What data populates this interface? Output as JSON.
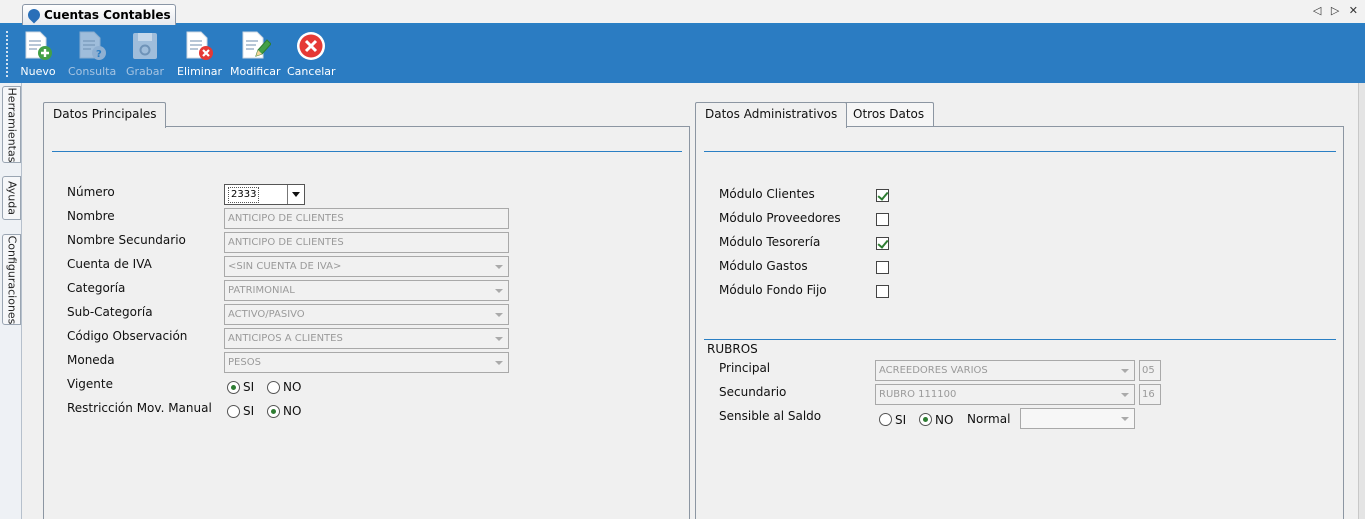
{
  "window": {
    "tab_title": "Cuentas Contables",
    "controls": "◁ ▷ ✕"
  },
  "toolbar": {
    "buttons": [
      {
        "label": "Nuevo",
        "icon": "new-document-icon",
        "enabled": true
      },
      {
        "label": "Consulta",
        "icon": "query-document-icon",
        "enabled": false
      },
      {
        "label": "Grabar",
        "icon": "save-disk-icon",
        "enabled": false
      },
      {
        "label": "Eliminar",
        "icon": "delete-document-icon",
        "enabled": true
      },
      {
        "label": "Modificar",
        "icon": "edit-document-icon",
        "enabled": true
      },
      {
        "label": "Cancelar",
        "icon": "cancel-icon",
        "enabled": true
      }
    ]
  },
  "sidebar": {
    "tabs": [
      "Herramientas",
      "Ayuda",
      "Configuraciones"
    ]
  },
  "main_panel": {
    "tab": "Datos Principales",
    "fields": {
      "numero": {
        "label": "Número",
        "value": "2333"
      },
      "nombre": {
        "label": "Nombre",
        "value": "ANTICIPO DE CLIENTES"
      },
      "nombre_secundario": {
        "label": "Nombre Secundario",
        "value": "ANTICIPO DE CLIENTES"
      },
      "cuenta_iva": {
        "label": "Cuenta de IVA",
        "value": "<SIN CUENTA DE IVA>"
      },
      "categoria": {
        "label": "Categoría",
        "value": "PATRIMONIAL"
      },
      "sub_categoria": {
        "label": "Sub-Categoría",
        "value": "ACTIVO/PASIVO"
      },
      "codigo_observacion": {
        "label": "Código Observación",
        "value": "ANTICIPOS A CLIENTES"
      },
      "moneda": {
        "label": "Moneda",
        "value": "PESOS"
      },
      "vigente": {
        "label": "Vigente",
        "options": [
          "SI",
          "NO"
        ],
        "selected": "SI"
      },
      "restriccion": {
        "label": "Restricción Mov. Manual",
        "options": [
          "SI",
          "NO"
        ],
        "selected": "NO"
      }
    }
  },
  "admin_panel": {
    "tabs": [
      "Datos Administrativos",
      "Otros Datos"
    ],
    "active_tab": "Datos Administrativos",
    "modules": [
      {
        "label": "Módulo Clientes",
        "checked": true
      },
      {
        "label": "Módulo Proveedores",
        "checked": false
      },
      {
        "label": "Módulo Tesorería",
        "checked": true
      },
      {
        "label": "Módulo Gastos",
        "checked": false
      },
      {
        "label": "Módulo Fondo Fijo",
        "checked": false
      }
    ],
    "rubros": {
      "title": "RUBROS",
      "principal": {
        "label": "Principal",
        "value": "ACREEDORES VARIOS",
        "code": "05"
      },
      "secundario": {
        "label": "Secundario",
        "value": "RUBRO 111100",
        "code": "16"
      },
      "sensible": {
        "label": "Sensible al Saldo",
        "options": [
          "SI",
          "NO"
        ],
        "selected": "NO"
      },
      "normal": {
        "label": "Normal",
        "value": ""
      }
    }
  },
  "colors": {
    "toolbar_bg": "#2b7cc2",
    "accent_line": "#2a7fc4",
    "check_green": "#2e7d32"
  }
}
